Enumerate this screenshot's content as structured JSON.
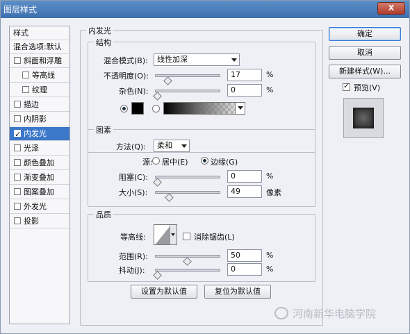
{
  "window": {
    "title": "图层样式",
    "close_label": "X"
  },
  "styles_panel": {
    "header": "样式",
    "blend_options": "混合选项:默认",
    "items": [
      {
        "label": "斜面和浮雕",
        "checked": false,
        "sub": false
      },
      {
        "label": "等高线",
        "checked": false,
        "sub": true
      },
      {
        "label": "纹理",
        "checked": false,
        "sub": true
      },
      {
        "label": "描边",
        "checked": false,
        "sub": false
      },
      {
        "label": "内阴影",
        "checked": false,
        "sub": false
      },
      {
        "label": "内发光",
        "checked": true,
        "sub": false,
        "selected": true
      },
      {
        "label": "光泽",
        "checked": false,
        "sub": false
      },
      {
        "label": "颜色叠加",
        "checked": false,
        "sub": false
      },
      {
        "label": "渐变叠加",
        "checked": false,
        "sub": false
      },
      {
        "label": "图案叠加",
        "checked": false,
        "sub": false
      },
      {
        "label": "外发光",
        "checked": false,
        "sub": false
      },
      {
        "label": "投影",
        "checked": false,
        "sub": false
      }
    ]
  },
  "inner_glow": {
    "title": "内发光",
    "structure": {
      "title": "结构",
      "blend_mode_label": "混合模式(B):",
      "blend_mode_value": "线性加深",
      "opacity_label": "不透明度(O):",
      "opacity_value": "17",
      "opacity_fraction": 0.17,
      "noise_label": "杂色(N):",
      "noise_value": "0",
      "noise_fraction": 0,
      "percent": "%",
      "color_swatch": "#000000"
    },
    "elements": {
      "title": "图素",
      "method_label": "方法(Q):",
      "method_value": "柔和",
      "source_label": "源:",
      "source_center": "居中(E)",
      "source_edge": "边缘(G)",
      "choke_label": "阻塞(C):",
      "choke_value": "0",
      "choke_fraction": 0,
      "size_label": "大小(S):",
      "size_value": "49",
      "size_unit": "像素",
      "size_fraction": 0.196
    },
    "quality": {
      "title": "品质",
      "contour_label": "等高线:",
      "antialias_label": "消除锯齿(L)",
      "range_label": "范围(R):",
      "range_value": "50",
      "range_fraction": 0.5,
      "jitter_label": "抖动(J):",
      "jitter_value": "0",
      "jitter_fraction": 0
    },
    "make_default": "设置为默认值",
    "reset_default": "复位为默认值"
  },
  "buttons": {
    "ok": "确定",
    "cancel": "取消",
    "new_style": "新建样式(W)...",
    "preview_label": "预览(V)"
  },
  "watermark": "河南新华电脑学院"
}
